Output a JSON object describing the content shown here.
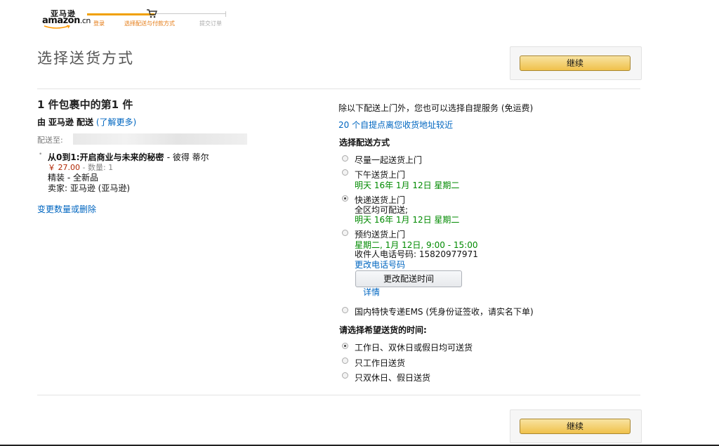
{
  "header": {
    "logo_cn": "亚马逊",
    "logo_wordmark": "amazon",
    "logo_suffix": ".cn",
    "steps": [
      "登录",
      "选择配送与付款方式",
      "提交订单"
    ]
  },
  "page_title": "选择送货方式",
  "continue_label": "继续",
  "package": {
    "title": "1 件包裹中的第1 件",
    "shipped_by_prefix": "由",
    "shipped_by_seller": "亚马逊 配送",
    "learn_more": "(了解更多)",
    "ship_to_label": "配送至:",
    "item": {
      "bullet": "•",
      "title": "从0到1:开启商业与未来的秘密",
      "author": "- 彼得 蒂尔",
      "price": "￥ 27.00",
      "qty": "- 数量: 1",
      "condition": "精装 - 全新品",
      "seller": "卖家: 亚马逊 (亚马逊)"
    },
    "change_qty_link": "变更数量或删除"
  },
  "shipping": {
    "pickup_note": "除以下配送上门外，您也可以选择自提服务 (免运费)",
    "pickup_link": "20 个自提点离您收货地址较近",
    "method_heading": "选择配送方式",
    "options": [
      {
        "label": "尽量一起送货上门",
        "selected": false
      },
      {
        "label": "下午送货上门",
        "date": "明天 16年 1月 12日 星期二",
        "selected": false
      },
      {
        "label": "快递送货上门",
        "note": "全区均可配送;",
        "date": "明天 16年 1月 12日 星期二",
        "selected": true
      },
      {
        "label": "预约送货上门",
        "date": "星期二, 1月 12日, 9:00 - 15:00",
        "phone_label": "收件人电话号码: 15820977971",
        "change_phone": "更改电话号码",
        "change_time": "更改配送时间",
        "details": "详情",
        "selected": false
      },
      {
        "label": "国内特快专递EMS (凭身份证签收，请实名下单)",
        "selected": false
      }
    ],
    "time_heading": "请选择希望送货的时间:",
    "time_options": [
      {
        "label": "工作日、双休日或假日均可送货",
        "selected": true
      },
      {
        "label": "只工作日送货",
        "selected": false
      },
      {
        "label": "只双休日、假日送货",
        "selected": false
      }
    ]
  }
}
